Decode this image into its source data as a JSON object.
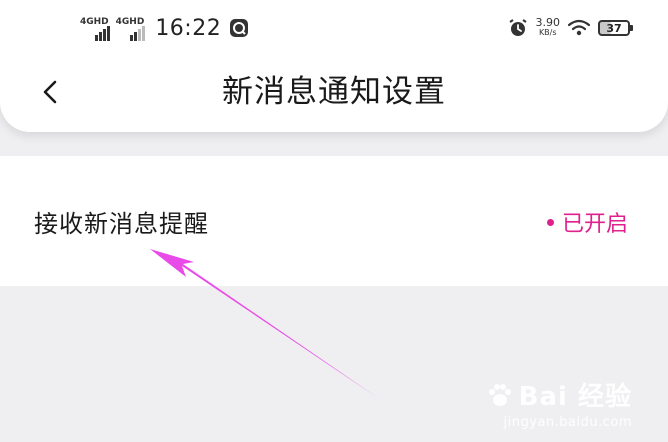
{
  "status_bar": {
    "network_1": "4GHD",
    "network_2": "4GHD",
    "time": "16:22",
    "speed_value": "3.90",
    "speed_unit": "KB/s",
    "battery": "37",
    "icons": [
      "signal-icon",
      "signal-icon",
      "app-notification-icon",
      "alarm-icon",
      "wifi-icon",
      "battery-icon"
    ]
  },
  "header": {
    "title": "新消息通知设置",
    "back_icon": "chevron-left-icon"
  },
  "settings": [
    {
      "label": "接收新消息提醒",
      "status": "已开启",
      "status_color": "#e0208c"
    }
  ],
  "watermark": {
    "brand": "Bai 经验",
    "url": "jingyan.baidu.com"
  },
  "colors": {
    "accent": "#e0208c",
    "annotation_arrow": "#e94be8",
    "background": "#efeff1"
  }
}
